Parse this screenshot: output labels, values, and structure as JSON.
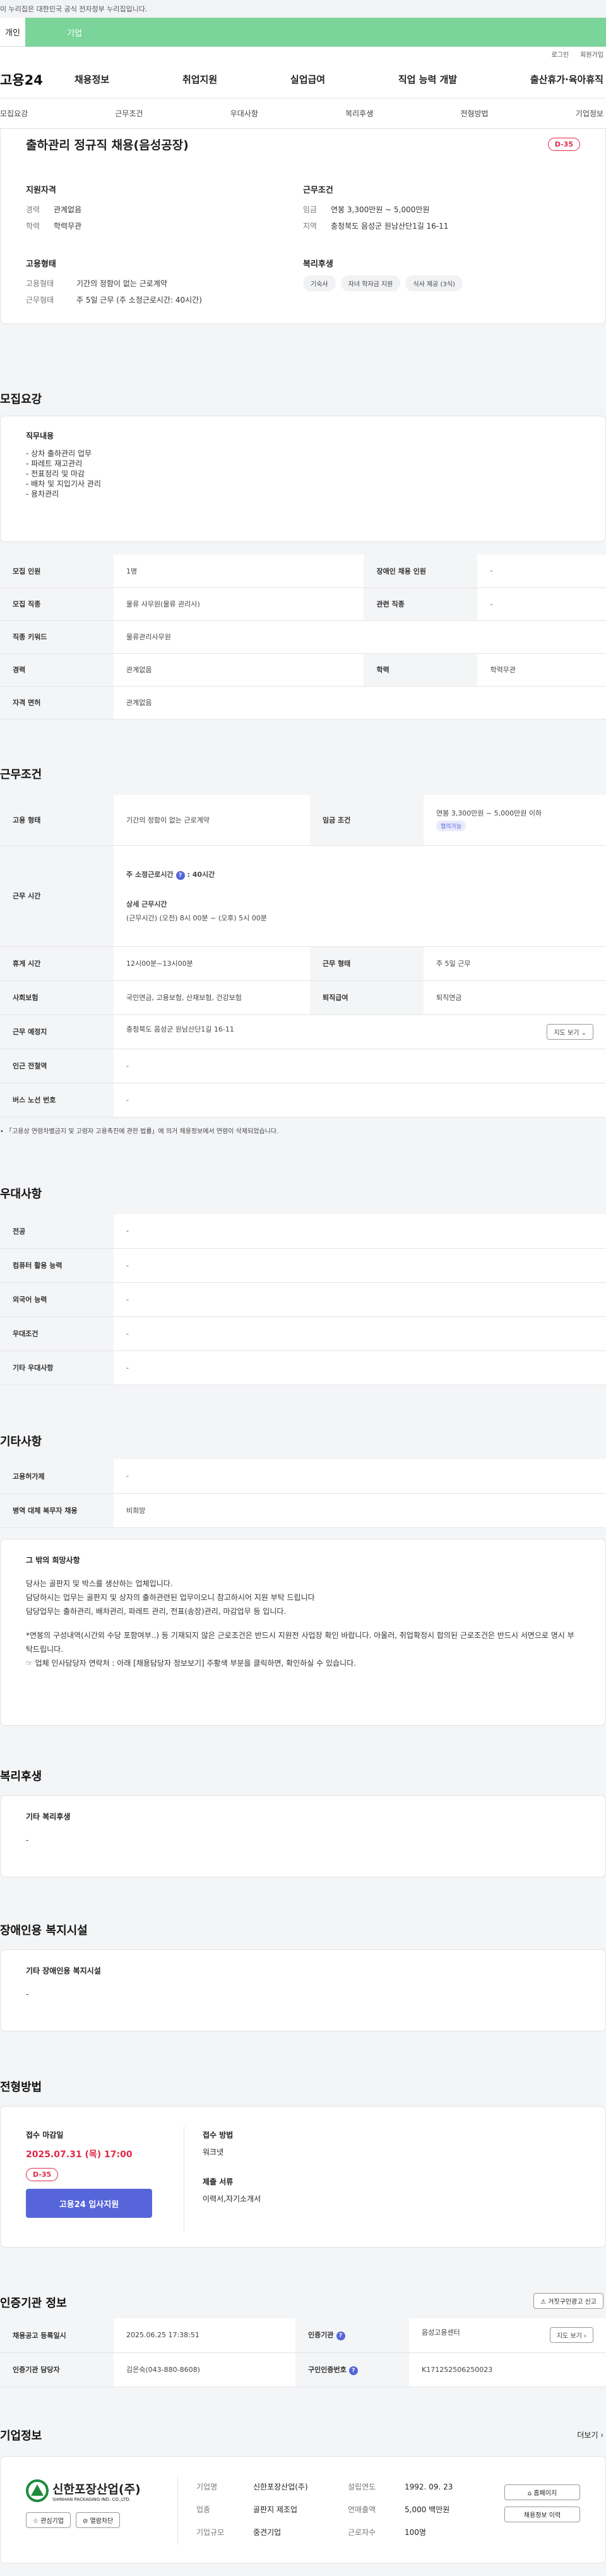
{
  "gov_notice": "이 누리집은 대한민국 공식 전자정부 누리집입니다.",
  "top_tabs": [
    "개인",
    "기업"
  ],
  "util": [
    "로그인",
    "회원가입"
  ],
  "logo": "고용24",
  "gnb": [
    "채용정보",
    "취업지원",
    "실업급여",
    "직업 능력 개발",
    "출산휴가·육아휴직"
  ],
  "subnav": [
    "모집요강",
    "근무조건",
    "우대사항",
    "복리후생",
    "전형방법",
    "기업정보"
  ],
  "job": {
    "title": "출하관리 정규직 채용(음성공장)",
    "dday": "D-35",
    "qual_title": "지원자격",
    "qual": [
      [
        "경력",
        "관계없음"
      ],
      [
        "학력",
        "학력무관"
      ]
    ],
    "cond_title": "근무조건",
    "cond": [
      [
        "임금",
        "연봉 3,300만원 ~ 5,000만원"
      ],
      [
        "지역",
        "충청북도 음성군 원남산단1길 16-11"
      ]
    ],
    "emp_title": "고용형태",
    "emp": [
      [
        "고용형태",
        "기간의 정함이 없는 근로계약"
      ],
      [
        "근무형태",
        "주 5일 근무 (주 소정근로시간: 40시간)"
      ]
    ],
    "ben_title": "복리후생",
    "ben": [
      "기숙사",
      "자녀 학자금 지원",
      "식사 제공 (3식)"
    ]
  },
  "req": {
    "title": "모집요강",
    "duty_title": "직무내용",
    "duty": [
      "- 상차 출하관리 업무",
      "- 파레트 재고관리",
      "- 전표정리 및 마감",
      "- 배차 및 지입기사 관리",
      "- 용차관리"
    ],
    "rows": [
      [
        "모집 인원",
        "1명",
        "장애인 채용 인원",
        "-"
      ],
      [
        "모집 직종",
        "물류 사무원(물류 관리사)",
        "관련 직종",
        "-"
      ],
      [
        "직종 키워드",
        "물류관리사무원",
        "",
        ""
      ],
      [
        "경력",
        "관계없음",
        "학력",
        "학력무관"
      ],
      [
        "자격 면허",
        "관계없음",
        "",
        ""
      ]
    ]
  },
  "work": {
    "title": "근무조건",
    "emp_k": "고용 형태",
    "emp_v": "기간의 정함이 없는 근로계약",
    "wage_k": "임금 조건",
    "wage_v": "연봉 3,300만원 ~ 5,000만원 이하",
    "wage_badge": "협의가능",
    "time_k": "근무 시간",
    "time_main": "주 소정근로시간",
    "time_main_v": ": 40시간",
    "time_detail_t": "상세 근무시간",
    "time_detail": "(근무시간) (오전) 8시 00분 ~ (오후) 5시 00분",
    "rows": [
      [
        "휴게 시간",
        "12시00분~13시00분",
        "근무 형태",
        "주 5일 근무"
      ],
      [
        "사회보험",
        "국민연금, 고용보험, 산재보험, 건강보험",
        "퇴직급여",
        "퇴직연금"
      ]
    ],
    "loc_k": "근무 예정지",
    "loc_v": "충청북도 음성군 원남산단1길 16-11",
    "map_btn": "지도 보기",
    "sub_k": "인근 전철역",
    "sub_v": "-",
    "bus_k": "버스 노선 번호",
    "bus_v": "-",
    "note": "「고용상 연령차별금지 및 고령자 고용촉진에 관한 법률」에 의거 채용정보에서 연령이 삭제되었습니다."
  },
  "pref": {
    "title": "우대사항",
    "rows": [
      [
        "전공",
        "-"
      ],
      [
        "컴퓨터 활용 능력",
        "-"
      ],
      [
        "외국어 능력",
        "-"
      ],
      [
        "우대조건",
        "-"
      ],
      [
        "기타 우대사항",
        "-"
      ]
    ]
  },
  "etc": {
    "title": "기타사항",
    "rows": [
      [
        "고용허가제",
        "-"
      ],
      [
        "병역 대체 복무자 채용",
        "비희망"
      ]
    ],
    "box_title": "그 밖의 희망사항",
    "lines": [
      "당사는 골판지 및 박스를 생산하는 업체입니다.",
      "담당하시는 업무는 골판지 및 상자의 출하관련된 업무이오니 참고하시어 지원 부탁 드립니다",
      "담당업무는 출하관리, 배차관리, 파레트 관리, 전표(송장)관리, 마감업무 등 입니다.",
      "",
      "*연봉의 구성내역(시간외 수당 포함여부..) 등 기재되지 않은 근로조건은 반드시 지원전 사업장 확인 바랍니다. 아울러, 취업확정시 합의된 근로조건은 반드시 서면으로 명시 부탁드립니다.",
      "☞ 업체 인사담당자 연락처 : 아래 [채용담당자 정보보기] 주황색 부분을 클릭하면, 확인하실 수 있습니다."
    ]
  },
  "welfare": {
    "title": "복리후생",
    "box_t": "기타 복리후생",
    "box_v": "-"
  },
  "dis": {
    "title": "장애인용 복지시설",
    "box_t": "기타 장애인용 복지시설",
    "box_v": "-"
  },
  "sel": {
    "title": "전형방법",
    "due_t": "접수 마감일",
    "due_v": "2025.07.31 (목) 17:00",
    "dday": "D-35",
    "apply": "고용24 입사지원",
    "method_t": "접수 방법",
    "method_v": "워크넷",
    "docs_t": "제출 서류",
    "docs_v": "이력서,자기소개서"
  },
  "cert": {
    "title": "인증기관 정보",
    "report_btn": "거짓구인광고 신고",
    "reg_k": "채용공고 등록일시",
    "reg_v": "2025.06.25 17:38:51",
    "org_k": "인증기관",
    "org_v": "음성고용센터",
    "map_btn": "지도 보기",
    "mgr_k": "인증기관 담당자",
    "mgr_v": "김은숙(043-880-8608)",
    "no_k": "구인인증번호",
    "no_v": "K171252506250023"
  },
  "company": {
    "title": "기업정보",
    "more": "더보기",
    "logo_ko": "신한포장산업(주)",
    "logo_en": "SHINHAN PACKAGING IND. CO.,LTD.",
    "fav": "관심기업",
    "block": "열람차단",
    "info": [
      [
        "기업명",
        "신한포장산업(주)",
        "설립연도",
        "1992. 09. 23"
      ],
      [
        "업종",
        "골판지 제조업",
        "연매출액",
        "5,000 백만원"
      ],
      [
        "기업규모",
        "중견기업",
        "근로자수",
        "100명"
      ]
    ],
    "home": "홈페이지",
    "other": "채용정보 이력"
  },
  "colors": {
    "accent": "#5666da",
    "red": "#e0294a",
    "green": "#7bd49a"
  }
}
